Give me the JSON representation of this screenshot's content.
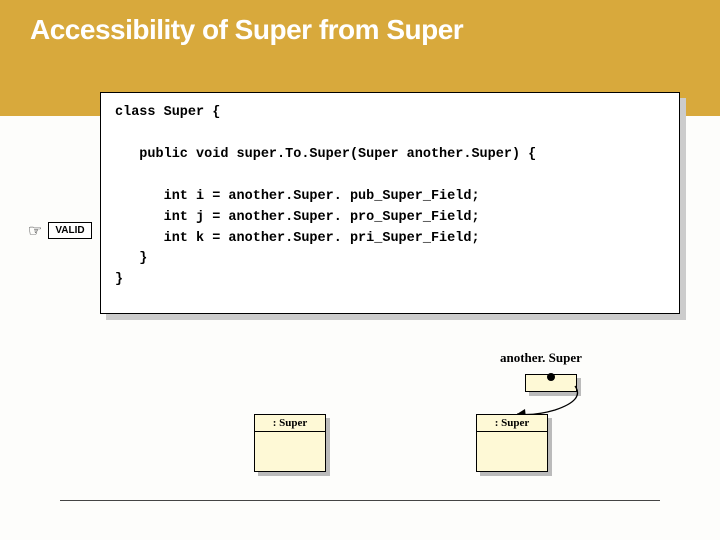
{
  "title": "Accessibility of Super from Super",
  "code": "class Super {\n\n   public void super.To.Super(Super another.Super) {\n\n      int i = another.Super. pub_Super_Field;\n      int j = another.Super. pro_Super_Field;\n      int k = another.Super. pri_Super_Field;\n   }\n}",
  "tag": "VALID",
  "ref_label": "another. Super",
  "uml": {
    "box1": ": Super",
    "box2": ": Super"
  }
}
